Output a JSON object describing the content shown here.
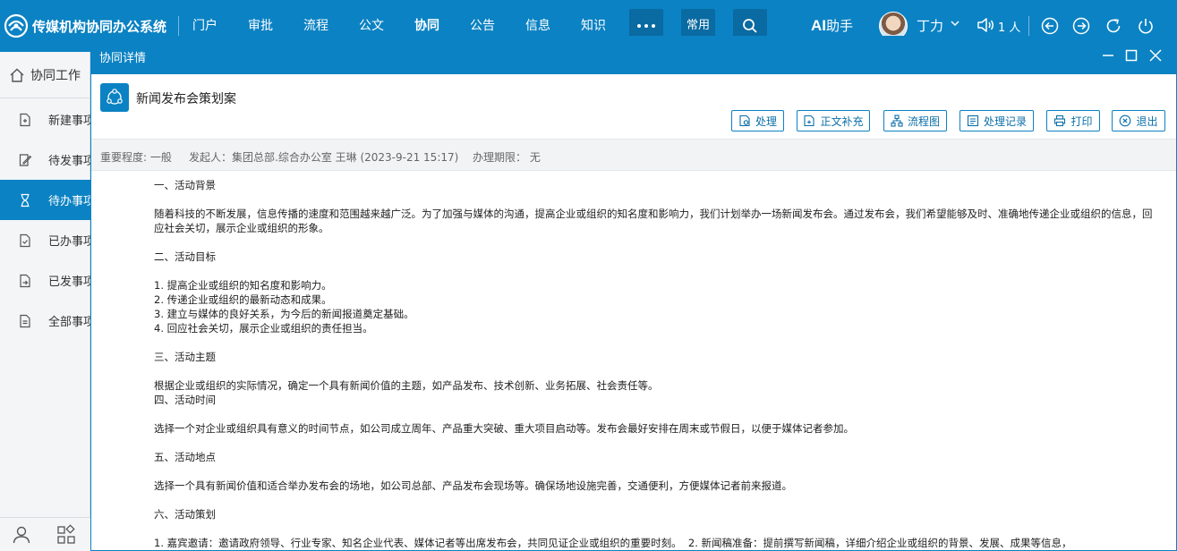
{
  "app": {
    "title": "传媒机构协同办公系统"
  },
  "nav": {
    "items": [
      {
        "label": "门户",
        "active": false
      },
      {
        "label": "审批",
        "active": false
      },
      {
        "label": "流程",
        "active": false
      },
      {
        "label": "公文",
        "active": false
      },
      {
        "label": "协同",
        "active": true
      },
      {
        "label": "公告",
        "active": false
      },
      {
        "label": "信息",
        "active": false
      },
      {
        "label": "知识",
        "active": false
      }
    ],
    "common_label": "常用",
    "ai_prefix": "AI",
    "ai_suffix": "助手",
    "user_name": "丁力",
    "online_count": "1 人"
  },
  "sidebar": {
    "title": "协同工作",
    "items": [
      {
        "label": "新建事项",
        "active": false
      },
      {
        "label": "待发事项",
        "active": false
      },
      {
        "label": "待办事项",
        "active": true
      },
      {
        "label": "已办事项",
        "active": false
      },
      {
        "label": "已发事项",
        "active": false
      },
      {
        "label": "全部事项",
        "active": false
      }
    ]
  },
  "modal": {
    "title": "协同详情",
    "doc_title": "新闻发布会策划案",
    "toolbar": {
      "process": "处理",
      "supplement": "正文补充",
      "flowchart": "流程图",
      "records": "处理记录",
      "print": "打印",
      "exit": "退出"
    },
    "meta": {
      "importance": "重要程度: 一般",
      "initiator": "发起人：集团总部.综合办公室  王琳 (2023-9-21 15:17)",
      "deadline": "办理期限： 无"
    },
    "content": [
      "一、活动背景",
      "",
      "随着科技的不断发展，信息传播的速度和范围越来越广泛。为了加强与媒体的沟通，提高企业或组织的知名度和影响力，我们计划举办一场新闻发布会。通过发布会，我们希望能够及时、准确地传递企业或组织的信息，回应社会关切，展示企业或组织的形象。",
      "",
      "二、活动目标",
      "",
      "1. 提高企业或组织的知名度和影响力。",
      "2. 传递企业或组织的最新动态和成果。",
      "3. 建立与媒体的良好关系，为今后的新闻报道奠定基础。",
      "4. 回应社会关切，展示企业或组织的责任担当。",
      "",
      "三、活动主题",
      "",
      "根据企业或组织的实际情况，确定一个具有新闻价值的主题，如产品发布、技术创新、业务拓展、社会责任等。",
      "四、活动时间",
      "",
      "选择一个对企业或组织具有意义的时间节点，如公司成立周年、产品重大突破、重大项目启动等。发布会最好安排在周末或节假日，以便于媒体记者参加。",
      "",
      "五、活动地点",
      "",
      "选择一个具有新闻价值和适合举办发布会的场地，如公司总部、产品发布会现场等。确保场地设施完善，交通便利，方便媒体记者前来报道。",
      "",
      "六、活动策划",
      "",
      "1. 嘉宾邀请：邀请政府领导、行业专家、知名企业代表、媒体记者等出席发布会，共同见证企业或组织的重要时刻。  2. 新闻稿准备：提前撰写新闻稿，详细介绍企业或组织的背景、发展、成果等信息，"
    ]
  }
}
